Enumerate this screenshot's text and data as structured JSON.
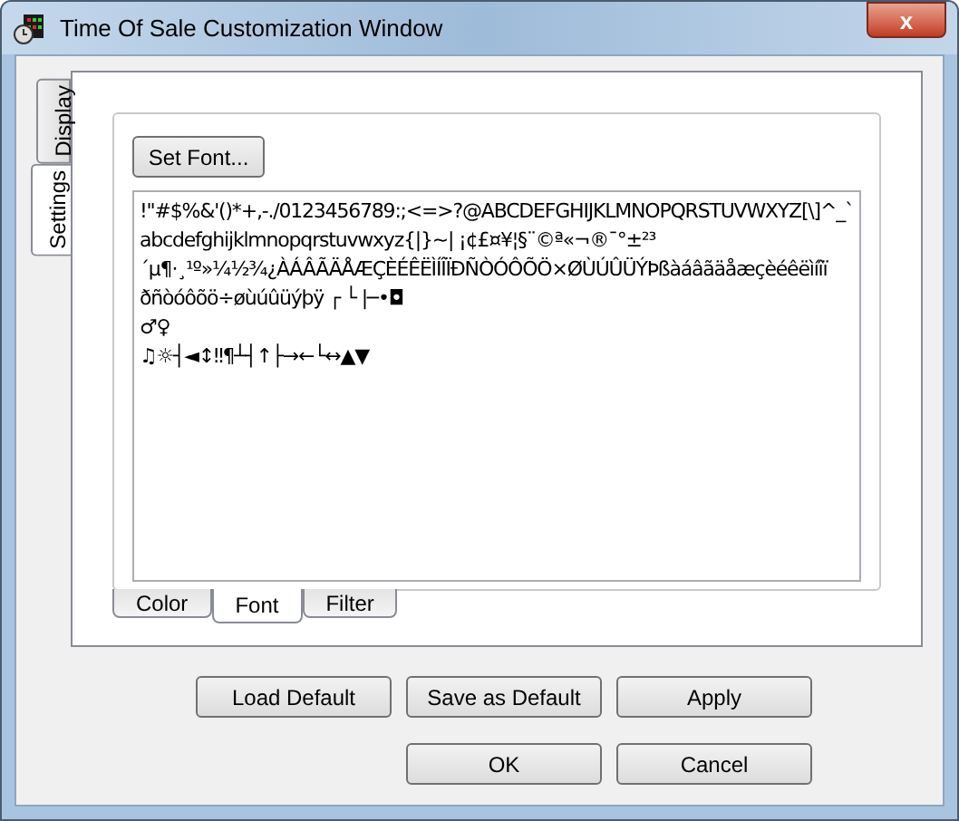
{
  "window": {
    "title": "Time Of Sale Customization Window",
    "close": "x"
  },
  "side_tabs": [
    {
      "label": "Display",
      "selected": false
    },
    {
      "label": "Settings",
      "selected": true
    }
  ],
  "font_panel": {
    "set_font_button": "Set Font...",
    "sample_lines": [
      "!\"#$%&'()*+,-./0123456789:;<=>?@ABCDEFGHIJKLMNOPQRSTUVWXYZ[\\]^_`",
      "abcdefghijklmnopqrstuvwxyz{|}~| ¡¢£¤¥¦§¨©ª«¬®¯°±²³",
      "´µ¶·¸¹º»¼½¾¿ÀÁÂÃÄÅÆÇÈÉÊËÌÍÎÏÐÑÒÓÔÕÖ×ØÙÚÛÜÝÞßàáâãäåæçèéêëìíîï",
      "ðñòóôõö÷øùúûüýþÿ ┌ └ |─•◘",
      "♂♀",
      "♫☼┤◄↕‼¶┴┤↑├→←└↔▲▼"
    ]
  },
  "bottom_tabs": [
    {
      "label": "Color",
      "selected": false
    },
    {
      "label": "Font",
      "selected": true
    },
    {
      "label": "Filter",
      "selected": false
    }
  ],
  "buttons": [
    [
      "Load Default",
      "Save as Default",
      "Apply"
    ],
    [
      "OK",
      "Cancel"
    ]
  ]
}
